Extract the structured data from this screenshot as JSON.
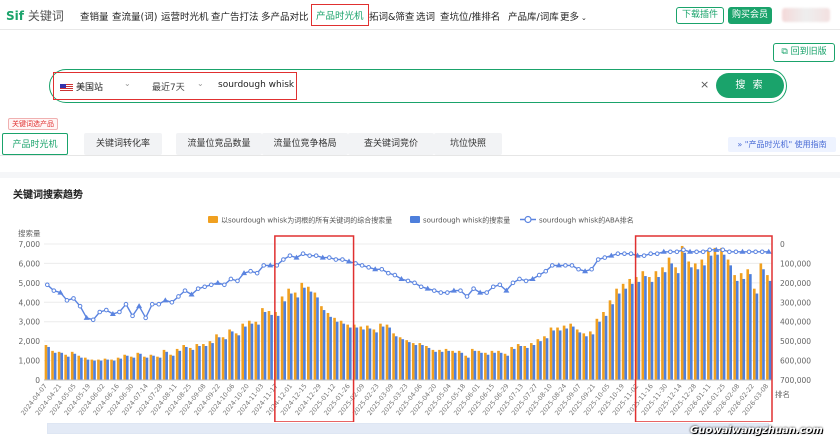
{
  "nav": {
    "logo_brand": "Sif",
    "logo_text": "关键词",
    "items": [
      "查销量",
      "查流量(词)",
      "运营时光机",
      "查广告打法",
      "多产品对比",
      "产品时光机",
      "拓词&筛查",
      "选词",
      "查坑位/推排名",
      "产品库/词库",
      "更多"
    ],
    "active": "产品时光机",
    "download_btn": "下载插件",
    "buy_btn": "购买会员"
  },
  "old_version_btn": "回到旧版",
  "search": {
    "site": "美国站",
    "range": "最近7天",
    "keyword": "sourdough whisk",
    "clear_icon": "×",
    "button": "搜 索"
  },
  "tag_label": "关键词选产品",
  "tabs": [
    "产品时光机",
    "关键词转化率",
    "流量位竞品数量",
    "流量位竞争格局",
    "查关键词竞价",
    "坑位快照"
  ],
  "active_tab": "产品时光机",
  "guide_link": "\"产品时光机\" 使用指南",
  "section_title": "关键词搜索趋势",
  "watermark": "Guowaiwangzhuan.com",
  "chart_data": {
    "type": "bar+line",
    "ylabel": "搜索量",
    "y2label": "排名",
    "ylim": [
      0,
      7000
    ],
    "y2lim": [
      0,
      700000
    ],
    "yticks": [
      "0",
      "1,000",
      "2,000",
      "3,000",
      "4,000",
      "5,000",
      "6,000",
      "7,000"
    ],
    "y2ticks": [
      "0",
      "100,000",
      "200,000",
      "300,000",
      "400,000",
      "500,000",
      "600,000",
      "700,000"
    ],
    "legend": [
      "以sourdough whisk为词根的所有关键词的综合搜索量",
      "sourdough whisk的搜索量",
      "sourdough whisk的ABA排名"
    ],
    "colors": {
      "bar_a": "#f0a020",
      "bar_b": "#4e7fdc",
      "line": "#5b84e0"
    },
    "xticks": [
      "2024-04-07",
      "2024-04-21",
      "2024-05-05",
      "2024-05-19",
      "2024-06-02",
      "2024-06-16",
      "2024-06-30",
      "2024-07-14",
      "2024-07-28",
      "2024-08-11",
      "2024-08-25",
      "2024-09-08",
      "2024-09-22",
      "2024-10-06",
      "2024-10-20",
      "2024-11-03",
      "2024-11-17",
      "2024-12-01",
      "2024-12-15",
      "2024-12-29",
      "2025-01-12",
      "2025-01-26",
      "2025-02-09",
      "2025-02-23",
      "2025-03-09",
      "2025-03-23",
      "2025-04-06",
      "2025-04-20",
      "2025-05-04",
      "2025-05-18",
      "2025-06-01",
      "2025-06-15",
      "2025-06-29",
      "2025-07-13",
      "2025-07-27",
      "2025-08-10",
      "2025-08-24",
      "2025-09-07",
      "2025-09-21",
      "2025-10-05",
      "2025-10-19",
      "2025-11-02",
      "2025-11-16",
      "2025-11-30",
      "2025-12-14",
      "2025-12-28",
      "2026-01-11",
      "2026-01-25",
      "2026-02-08",
      "2026-02-22",
      "2026-03-08"
    ],
    "bar_a": [
      1800,
      1500,
      1450,
      1300,
      1450,
      1250,
      1150,
      1050,
      1050,
      1100,
      1050,
      1150,
      1300,
      1200,
      1400,
      1200,
      1300,
      1200,
      1550,
      1300,
      1600,
      1800,
      1650,
      1850,
      1850,
      2000,
      2350,
      2200,
      2600,
      2400,
      2900,
      3050,
      3000,
      3700,
      3550,
      3500,
      4300,
      4700,
      4500,
      5000,
      4800,
      4500,
      3800,
      3450,
      3200,
      3050,
      2850,
      2850,
      2750,
      2800,
      2600,
      2900,
      2850,
      2400,
      2200,
      2050,
      1900,
      1900,
      1750,
      1550,
      1550,
      1600,
      1500,
      1500,
      1250,
      1600,
      1500,
      1400,
      1500,
      1500,
      1350,
      1700,
      1850,
      1750,
      1900,
      2100,
      2250,
      2700,
      2700,
      2800,
      2900,
      2600,
      2400,
      2500,
      3150,
      3500,
      4100,
      4700,
      4950,
      5200,
      5300,
      5600,
      5300,
      5600,
      5800,
      6300,
      5800,
      6900,
      6100,
      6000,
      6200,
      6700,
      6800,
      6800,
      6200,
      5400,
      5500,
      5700,
      4700,
      6000,
      5400
    ],
    "bar_b": [
      1700,
      1400,
      1400,
      1200,
      1350,
      1150,
      1050,
      1000,
      1000,
      1050,
      1000,
      1100,
      1250,
      1150,
      1350,
      1150,
      1250,
      1150,
      1450,
      1250,
      1500,
      1700,
      1550,
      1750,
      1750,
      1900,
      2200,
      2100,
      2500,
      2300,
      2750,
      2900,
      2850,
      3500,
      3350,
      3300,
      4050,
      4450,
      4250,
      4750,
      4550,
      4250,
      3600,
      3250,
      3000,
      2900,
      2700,
      2700,
      2600,
      2650,
      2450,
      2750,
      2700,
      2250,
      2100,
      1950,
      1800,
      1800,
      1650,
      1450,
      1450,
      1500,
      1400,
      1400,
      1150,
      1500,
      1400,
      1300,
      1400,
      1400,
      1250,
      1600,
      1750,
      1650,
      1800,
      2000,
      2150,
      2550,
      2550,
      2650,
      2750,
      2450,
      2250,
      2350,
      3000,
      3300,
      3900,
      4450,
      4700,
      4950,
      5050,
      5350,
      5050,
      5300,
      5550,
      6000,
      5500,
      6550,
      5800,
      5700,
      5900,
      6400,
      6450,
      6450,
      5900,
      5100,
      5200,
      5450,
      4450,
      5700,
      5100
    ],
    "rank_line": [
      210000,
      240000,
      250000,
      290000,
      280000,
      320000,
      380000,
      390000,
      350000,
      340000,
      360000,
      350000,
      310000,
      370000,
      320000,
      380000,
      310000,
      310000,
      290000,
      300000,
      270000,
      240000,
      260000,
      230000,
      220000,
      210000,
      200000,
      210000,
      180000,
      190000,
      150000,
      140000,
      150000,
      110000,
      110000,
      110000,
      80000,
      60000,
      70000,
      50000,
      60000,
      60000,
      70000,
      70000,
      80000,
      80000,
      90000,
      100000,
      110000,
      120000,
      130000,
      130000,
      150000,
      160000,
      180000,
      190000,
      200000,
      220000,
      230000,
      240000,
      250000,
      250000,
      240000,
      240000,
      270000,
      230000,
      250000,
      250000,
      220000,
      210000,
      240000,
      200000,
      180000,
      190000,
      180000,
      160000,
      140000,
      110000,
      110000,
      110000,
      110000,
      130000,
      140000,
      130000,
      80000,
      70000,
      60000,
      50000,
      50000,
      50000,
      60000,
      60000,
      50000,
      50000,
      40000,
      40000,
      40000,
      30000,
      40000,
      40000,
      40000,
      30000,
      30000,
      30000,
      40000,
      40000,
      40000,
      40000,
      40000,
      40000,
      40000
    ],
    "highlights": [
      {
        "from": "2024-11-17",
        "to": "2025-01-26"
      },
      {
        "from": "2025-11-02",
        "to": "2026-03-08"
      }
    ]
  }
}
